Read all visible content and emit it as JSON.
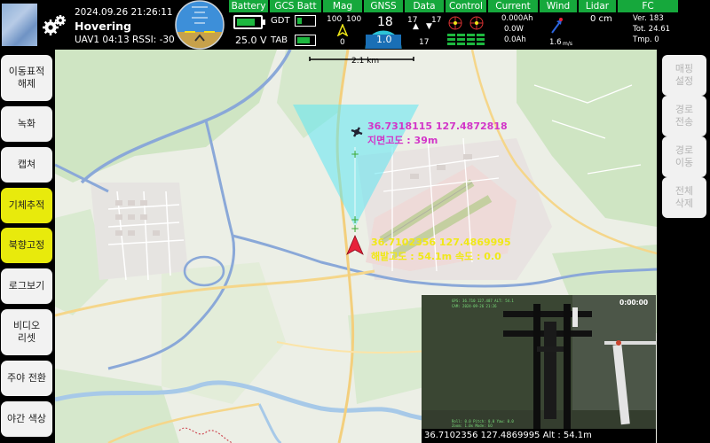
{
  "header": {
    "datetime": "2024.09.26 21:26:11",
    "mode": "Hovering",
    "uav_info": "UAV1 04:13 RSSI: -30",
    "battery": {
      "label": "Battery",
      "voltage": "25.0 V",
      "level": 0.8
    },
    "gcs_batt": {
      "label": "GCS Batt",
      "gdt_label": "GDT",
      "tab_label": "TAB",
      "gdt_level": 0.3,
      "tab_level": 0.8
    },
    "mag": {
      "label": "Mag",
      "val_left": "100",
      "val_right": "100",
      "val_bottom": "0"
    },
    "gnss": {
      "label": "GNSS",
      "sats": "18",
      "hdop": "1.0"
    },
    "data": {
      "label": "Data",
      "up": "17",
      "down": "17"
    },
    "control": {
      "label": "Control"
    },
    "current": {
      "label": "Current",
      "line1": "0.000Ah",
      "line2": "0.0W",
      "line3": "0.0Ah"
    },
    "wind": {
      "label": "Wind",
      "speed": "1.6",
      "unit": "m/s"
    },
    "lidar": {
      "label": "Lidar",
      "value": "0 cm"
    },
    "fc": {
      "label": "FC",
      "ver": "Ver. 183",
      "tot": "Tot. 24.61",
      "tmp": "Tmp. 0"
    }
  },
  "left_buttons": [
    {
      "label": "이동표적\n해제"
    },
    {
      "label": "녹화"
    },
    {
      "label": "캡쳐"
    },
    {
      "label": "기체추적"
    },
    {
      "label": "북향고정"
    },
    {
      "label": "로그보기"
    },
    {
      "label": "비디오\n리셋"
    },
    {
      "label": "주야 전환"
    },
    {
      "label": "야간 색상"
    }
  ],
  "right_buttons": [
    {
      "label": "매핑\n설정"
    },
    {
      "label": "경로\n전송"
    },
    {
      "label": "경로\n이동"
    },
    {
      "label": "전체\n삭제"
    }
  ],
  "map": {
    "scale": "2.1 km",
    "target": {
      "coords": "36.7318115 127.4872818",
      "alt": "지면고도 : 39m"
    },
    "drone": {
      "coords": "36.7102356 127.4869995",
      "alt": "해발고도 : 54.1m 속도 : 0.0"
    }
  },
  "video": {
    "timer": "0:00:00",
    "caption": "36.7102356 127.4869995 Alt : 54.1m"
  },
  "colors": {
    "tab_green": "#16a83c",
    "button_yellow": "#e8ea0c",
    "label_magenta": "#d235c8",
    "label_yellow": "#f0e818",
    "view_cone": "#5fe6f2"
  }
}
